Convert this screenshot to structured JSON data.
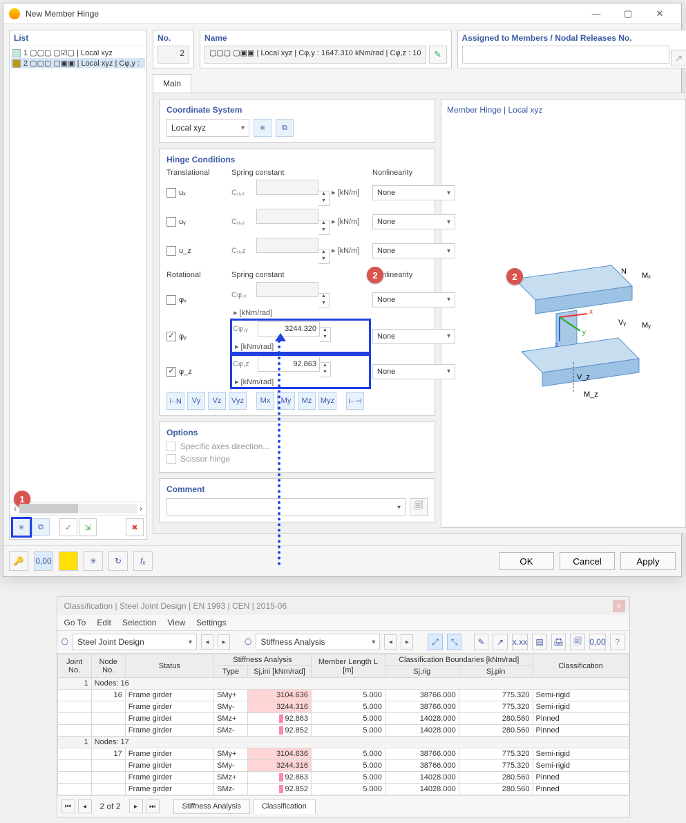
{
  "dialog": {
    "title": "New Member Hinge",
    "list_header": "List",
    "list_items": [
      {
        "no": 1,
        "text": "1  ▢▢▢  ▢☑▢ | Local xyz",
        "swatch": "#bfe8e2"
      },
      {
        "no": 2,
        "text": "2  ▢▢▢  ▢▣▣ | Local xyz | Cφ,y :",
        "swatch": "#b59b18"
      }
    ],
    "no_label": "No.",
    "no_value": "2",
    "name_label": "Name",
    "name_value": "▢▢▢  ▢▣▣ | Local xyz | Cφ,y : 1647.310 kNm/rad | Cφ,z : 10",
    "assigned_label": "Assigned to Members / Nodal Releases No.",
    "tab_main": "Main",
    "coord_title": "Coordinate System",
    "coord_value": "Local xyz",
    "hinge_title": "Hinge Conditions",
    "translational_label": "Translational",
    "spring_constant_label": "Spring constant",
    "nonlinearity_label": "Nonlinearity",
    "rotational_label": "Rotational",
    "rows_trans": [
      {
        "dof": "uₓ",
        "sc": "Cᵤ,ₓ",
        "unit": "[kN/m]",
        "checked": false
      },
      {
        "dof": "uᵧ",
        "sc": "Cᵤ,ᵧ",
        "unit": "[kN/m]",
        "checked": false
      },
      {
        "dof": "u_z",
        "sc": "Cᵤ,z",
        "unit": "[kN/m]",
        "checked": false
      }
    ],
    "rows_rot": [
      {
        "dof": "φₓ",
        "sc": "Cφ,ₓ",
        "val": "",
        "unit": "[kNm/rad]",
        "checked": false
      },
      {
        "dof": "φᵧ",
        "sc": "Cφ,ᵧ",
        "val": "3244.320",
        "unit": "[kNm/rad]",
        "checked": true
      },
      {
        "dof": "φ_z",
        "sc": "Cφ,z",
        "val": "92.863",
        "unit": "[kNm/rad]",
        "checked": true
      }
    ],
    "nl_value": "None",
    "options_title": "Options",
    "opt_specific": "Specific axes direction...",
    "opt_scissor": "Scissor hinge",
    "comment_title": "Comment",
    "preview_title": "Member Hinge | Local xyz",
    "btn_ok": "OK",
    "btn_cancel": "Cancel",
    "btn_apply": "Apply",
    "marker1": "1",
    "marker2": "2"
  },
  "results": {
    "title": "Classification | Steel Joint Design | EN 1993 | CEN | 2015-06",
    "menu": [
      "Go To",
      "Edit",
      "Selection",
      "View",
      "Settings"
    ],
    "combo1": "Steel Joint Design",
    "combo2": "Stiffness Analysis",
    "headers": {
      "joint": "Joint\nNo.",
      "node": "Node\nNo.",
      "status": "Status",
      "stiff": "Stiffness Analysis",
      "type": "Type",
      "sj": "Sj,ini [kNm/rad]",
      "len": "Member Length\nL [m]",
      "bounds": "Classification Boundaries [kNm/rad]",
      "rig": "Sj,rig",
      "pin": "Sj,pin",
      "class": "Classification"
    },
    "groups": [
      {
        "joint": "1",
        "node_caption": "Nodes: 16",
        "node": "16",
        "rows": [
          {
            "status": "Frame girder",
            "type": "SMy+",
            "sj": "3104.636",
            "hot": true,
            "len": "5.000",
            "rig": "38766.000",
            "pin": "775.320",
            "class": "Semi-rigid"
          },
          {
            "status": "Frame girder",
            "type": "SMy-",
            "sj": "3244.316",
            "hot": true,
            "len": "5.000",
            "rig": "38766.000",
            "pin": "775.320",
            "class": "Semi-rigid"
          },
          {
            "status": "Frame girder",
            "type": "SMz+",
            "sj": "92.863",
            "hot": false,
            "len": "5.000",
            "rig": "14028.000",
            "pin": "280.560",
            "class": "Pinned"
          },
          {
            "status": "Frame girder",
            "type": "SMz-",
            "sj": "92.852",
            "hot": false,
            "len": "5.000",
            "rig": "14028.000",
            "pin": "280.560",
            "class": "Pinned"
          }
        ]
      },
      {
        "joint": "1",
        "node_caption": "Nodes: 17",
        "node": "17",
        "rows": [
          {
            "status": "Frame girder",
            "type": "SMy+",
            "sj": "3104.636",
            "hot": true,
            "len": "5.000",
            "rig": "38766.000",
            "pin": "775.320",
            "class": "Semi-rigid"
          },
          {
            "status": "Frame girder",
            "type": "SMy-",
            "sj": "3244.316",
            "hot": true,
            "len": "5.000",
            "rig": "38766.000",
            "pin": "775.320",
            "class": "Semi-rigid"
          },
          {
            "status": "Frame girder",
            "type": "SMz+",
            "sj": "92.863",
            "hot": false,
            "len": "5.000",
            "rig": "14028.000",
            "pin": "280.560",
            "class": "Pinned"
          },
          {
            "status": "Frame girder",
            "type": "SMz-",
            "sj": "92.852",
            "hot": false,
            "len": "5.000",
            "rig": "14028.000",
            "pin": "280.560",
            "class": "Pinned"
          }
        ]
      }
    ],
    "page_label": "2 of 2",
    "tabs": [
      "Stiffness Analysis",
      "Classification"
    ]
  }
}
